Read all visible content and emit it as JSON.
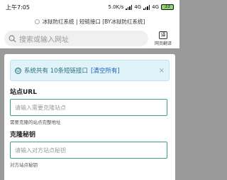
{
  "statusbar": {
    "time": "上午7:05",
    "speed": "5.0K/s",
    "net1": "4G",
    "net2": "4G",
    "battery": "33"
  },
  "titlebar": {
    "title": "冰狱防红系统 | 短链接口 [BY冰狱防红系统]"
  },
  "search": {
    "placeholder": "搜索或输入网址",
    "translate_label": "网页翻译",
    "translate_icon_text": "译"
  },
  "alert": {
    "text": "系统共有 10条短链接口 ",
    "link": "[清空所有]",
    "close": "×"
  },
  "form": {
    "site_url_label": "站点URL",
    "site_url_placeholder": "请输入需要克隆站点",
    "site_url_help": "需要克隆的站点完整地址",
    "clone_key_label": "克隆秘钥",
    "clone_key_placeholder": "请输入对方站点秘钥",
    "clone_key_help": "对方站点秘钥"
  }
}
